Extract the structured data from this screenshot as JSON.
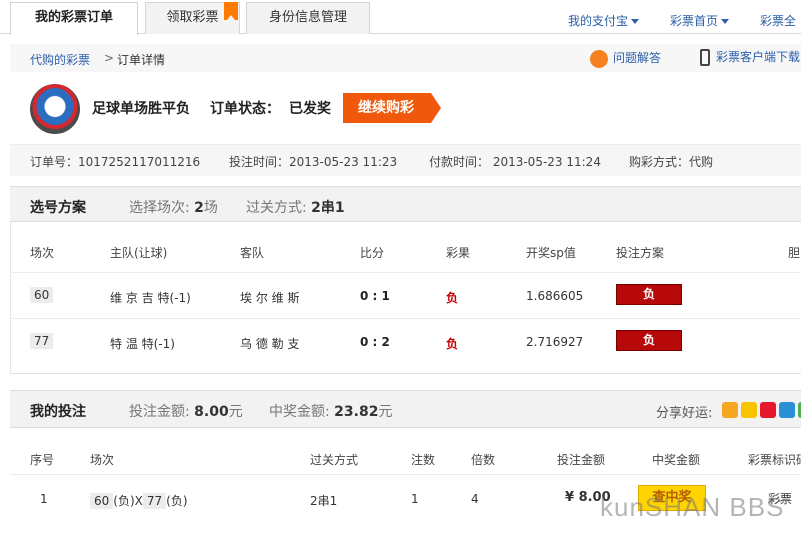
{
  "tabs": [
    {
      "label": "我的彩票订单"
    },
    {
      "label": "领取彩票"
    },
    {
      "label": "身份信息管理"
    }
  ],
  "toplinks": {
    "alipay": "我的支付宝",
    "lottery_home": "彩票首页",
    "lottery_all": "彩票全"
  },
  "breadcrumb": {
    "parent": "代购的彩票",
    "sep": ">",
    "current": "订单详情"
  },
  "help": {
    "faq": "问题解答",
    "client_download": "彩票客户端下载"
  },
  "order": {
    "title": "足球单场胜平负",
    "status_label": "订单状态：",
    "status_value": "已发奖",
    "continue_label": "继续购彩",
    "order_no": "订单号：1017252117011216",
    "bet_time": "投注时间：2013-05-23 11:23",
    "pay_time": "付款时间： 2013-05-23 11:24",
    "buy_method": "购彩方式：代购"
  },
  "selection": {
    "title": "选号方案",
    "matches_label": "选择场次:",
    "matches_count": "2",
    "matches_unit": "场",
    "pass_label": "过关方式:",
    "pass_value": "2串1",
    "headers": [
      "场次",
      "主队(让球)",
      "客队",
      "比分",
      "彩果",
      "开奖sp值",
      "投注方案",
      "胆"
    ],
    "rows": [
      {
        "id": "60",
        "home": "维 京 吉 特(-1)",
        "away": "埃 尔 维 斯",
        "score": "0 : 1",
        "result": "负",
        "sp": "1.686605",
        "bet": "负"
      },
      {
        "id": "77",
        "home": "特 温 特(-1)",
        "away": "乌 德 勒 支",
        "score": "0 : 2",
        "result": "负",
        "sp": "2.716927",
        "bet": "负"
      }
    ]
  },
  "my_bet": {
    "title": "我的投注",
    "amount_label": "投注金额:",
    "amount_value": "8.00",
    "amount_unit": "元",
    "prize_label": "中奖金额:",
    "prize_value": "23.82",
    "prize_unit": "元",
    "share_label": "分享好运:",
    "headers": [
      "序号",
      "场次",
      "过关方式",
      "注数",
      "倍数",
      "投注金额",
      "中奖金额",
      "彩票标识码"
    ],
    "rows": [
      {
        "seq": "1",
        "m1": "60",
        "r1": "(负)X",
        "m2": "77",
        "r2": "(负)",
        "pass": "2串1",
        "notes": "1",
        "multiple": "4",
        "amount": "¥ 8.00",
        "prize_btn": "查中奖",
        "code": "彩票"
      }
    ]
  },
  "watermark": "kunSHAN BBS",
  "colors": {
    "accent": "#f0590c",
    "link": "#2a5ea8",
    "bet_red": "#b8090a"
  }
}
